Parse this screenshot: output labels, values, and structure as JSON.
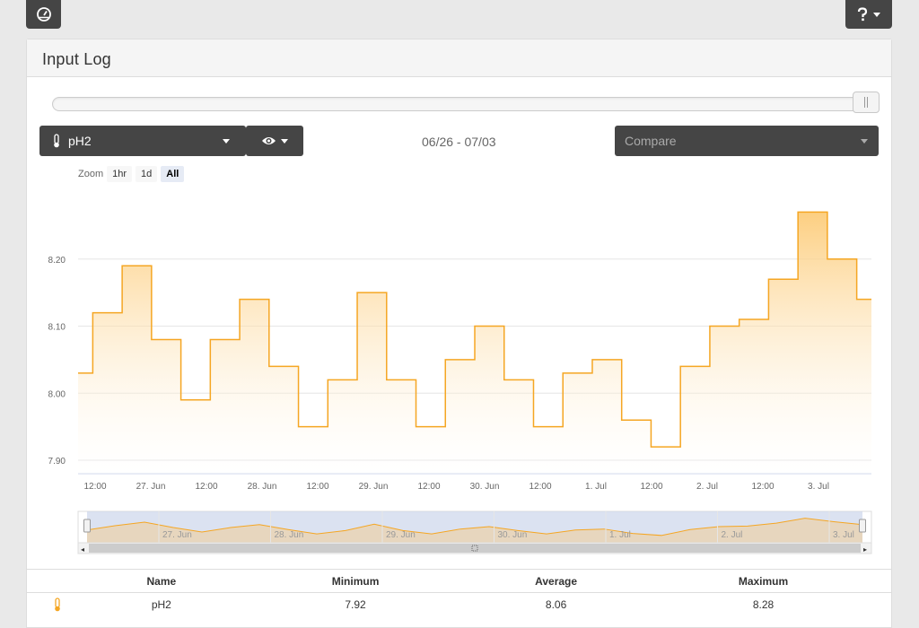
{
  "toolbar": {
    "dashboard_icon": "dashboard-icon",
    "help_icon": "help-icon"
  },
  "panel": {
    "title": "Input Log"
  },
  "controls": {
    "input_select": "pH2",
    "input_icon": "thermometer-icon",
    "view_icon": "eye-icon",
    "date_range": "06/26 - 07/03",
    "compare_placeholder": "Compare",
    "range_slider_value": 1.0
  },
  "zoom": {
    "label": "Zoom",
    "options": [
      "1hr",
      "1d",
      "All"
    ],
    "active": "All"
  },
  "colors": {
    "series": "#f5a623",
    "series_fill_top": "#fcc66a",
    "navigator_bg": "#ccd6eb",
    "panel_bg": "#454545"
  },
  "chart_data": {
    "type": "area",
    "series": [
      {
        "name": "pH2",
        "x": [
          "06/26 12:00",
          "06/26 18:00",
          "06/27 00:00",
          "06/27 06:00",
          "06/27 12:00",
          "06/27 18:00",
          "06/28 00:00",
          "06/28 06:00",
          "06/28 12:00",
          "06/28 18:00",
          "06/29 00:00",
          "06/29 06:00",
          "06/29 12:00",
          "06/29 18:00",
          "06/30 00:00",
          "06/30 06:00",
          "06/30 12:00",
          "06/30 18:00",
          "07/01 00:00",
          "07/01 06:00",
          "07/01 12:00",
          "07/01 18:00",
          "07/02 00:00",
          "07/02 06:00",
          "07/02 12:00",
          "07/02 18:00",
          "07/03 00:00",
          "07/03 06:00"
        ],
        "values": [
          8.03,
          8.12,
          8.19,
          8.08,
          7.99,
          8.08,
          8.14,
          8.04,
          7.95,
          8.02,
          8.15,
          8.02,
          7.95,
          8.05,
          8.1,
          8.02,
          7.95,
          8.03,
          8.05,
          7.96,
          7.92,
          8.04,
          8.1,
          8.11,
          8.17,
          8.27,
          8.2,
          8.14
        ]
      }
    ],
    "y_ticks": [
      7.9,
      8.0,
      8.1,
      8.2
    ],
    "y_tick_labels": [
      "7.90",
      "8.00",
      "8.10",
      "8.20"
    ],
    "ylim": [
      7.88,
      8.3
    ],
    "x_tick_labels": [
      "12:00",
      "27. Jun",
      "12:00",
      "28. Jun",
      "12:00",
      "29. Jun",
      "12:00",
      "30. Jun",
      "12:00",
      "1. Jul",
      "12:00",
      "2. Jul",
      "12:00",
      "3. Jul"
    ],
    "navigator_labels": [
      "27. Jun",
      "28. Jun",
      "29. Jun",
      "30. Jun",
      "1. Jul",
      "2. Jul",
      "3. Jul"
    ],
    "grid": true,
    "legend": "none",
    "title": "",
    "xlabel": "",
    "ylabel": ""
  },
  "stats": {
    "headers": {
      "name": "Name",
      "minimum": "Minimum",
      "average": "Average",
      "maximum": "Maximum"
    },
    "rows": [
      {
        "icon": "thermometer-icon",
        "name": "pH2",
        "minimum": "7.92",
        "average": "8.06",
        "maximum": "8.28"
      }
    ]
  }
}
